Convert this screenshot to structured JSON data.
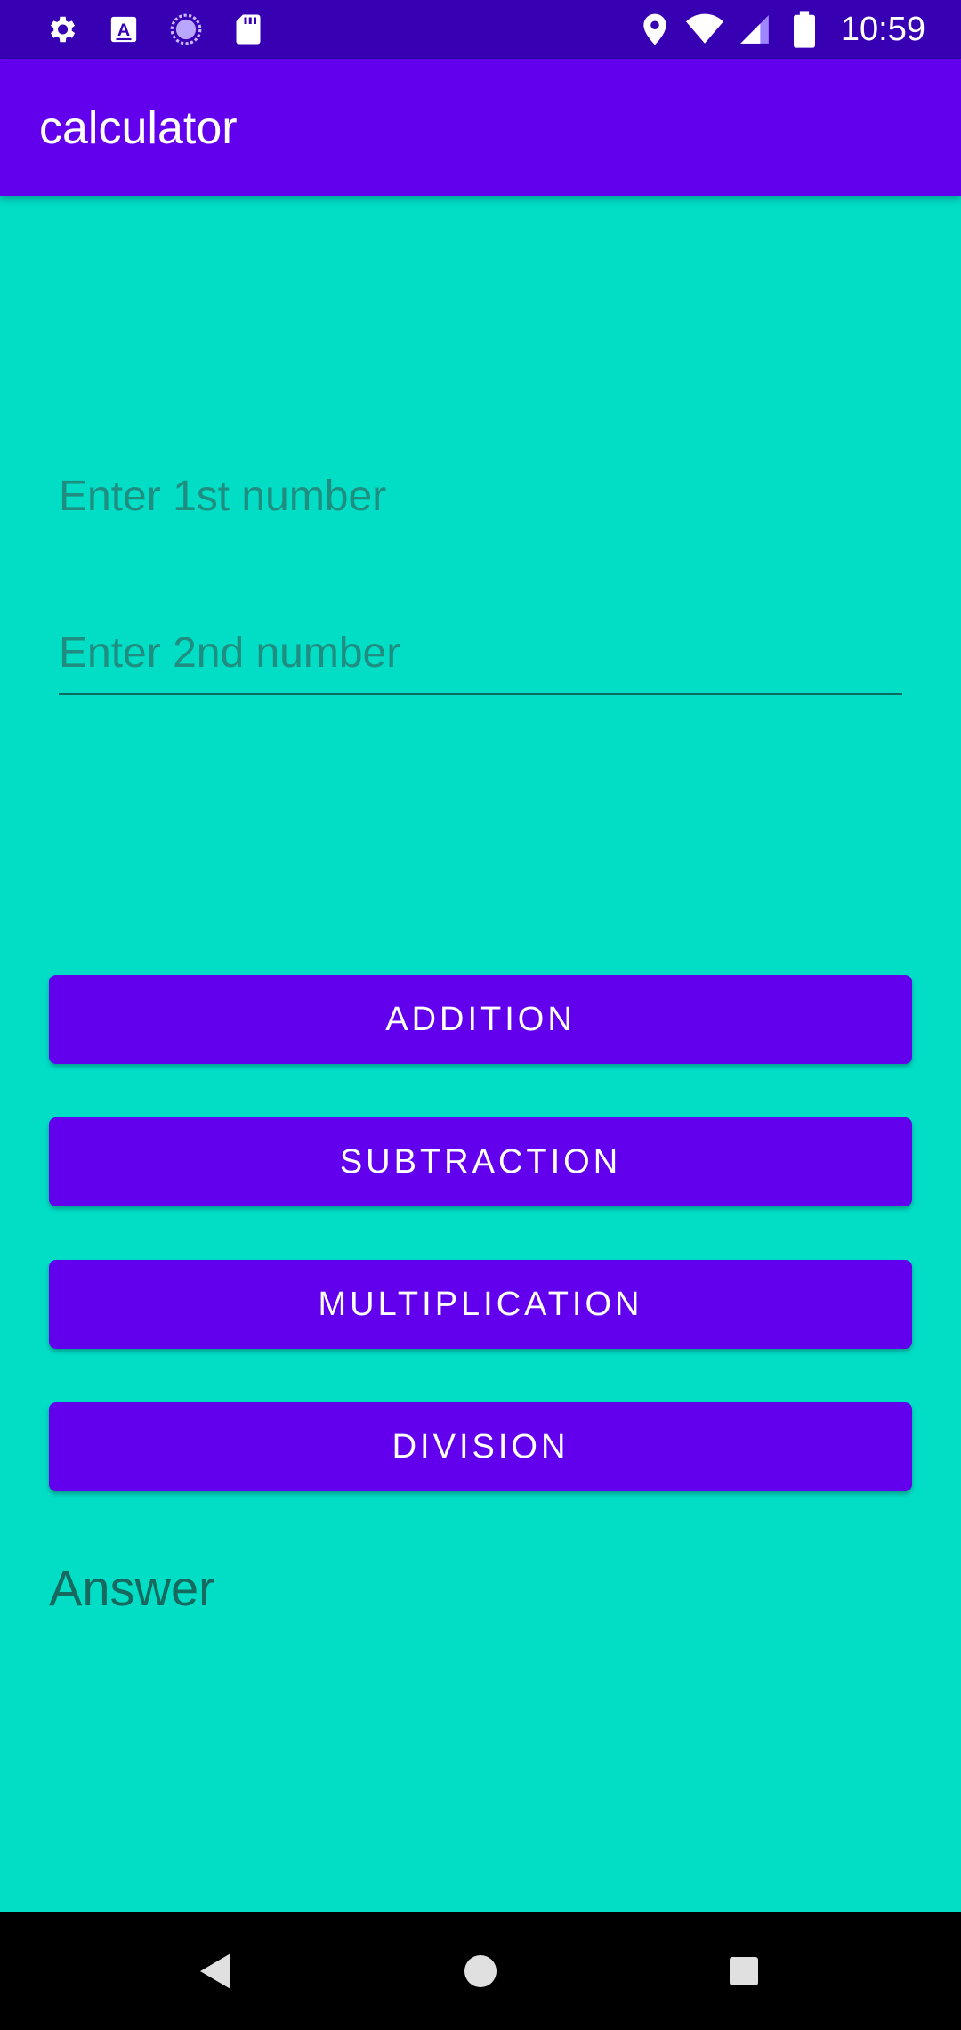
{
  "status_bar": {
    "time": "10:59",
    "left_icons": [
      "gear-icon",
      "font-a-icon",
      "loading-circle-icon",
      "sd-card-icon"
    ],
    "right_icons": [
      "location-pin-icon",
      "wifi-icon",
      "signal-icon",
      "battery-icon"
    ]
  },
  "app_bar": {
    "title": "calculator"
  },
  "inputs": {
    "first": {
      "placeholder": "Enter 1st number",
      "value": ""
    },
    "second": {
      "placeholder": "Enter 2nd number",
      "value": ""
    }
  },
  "buttons": {
    "addition": "ADDITION",
    "subtraction": "SUBTRACTION",
    "multiplication": "MULTIPLICATION",
    "division": "DIVISION"
  },
  "result": {
    "answer_label": "Answer"
  },
  "nav_bar": {
    "icons": [
      "back-icon",
      "home-icon",
      "recents-icon"
    ]
  },
  "colors": {
    "status_bar": "#3700B3",
    "primary": "#6200EE",
    "background": "#02DDC6",
    "nav_bar": "#000000"
  }
}
